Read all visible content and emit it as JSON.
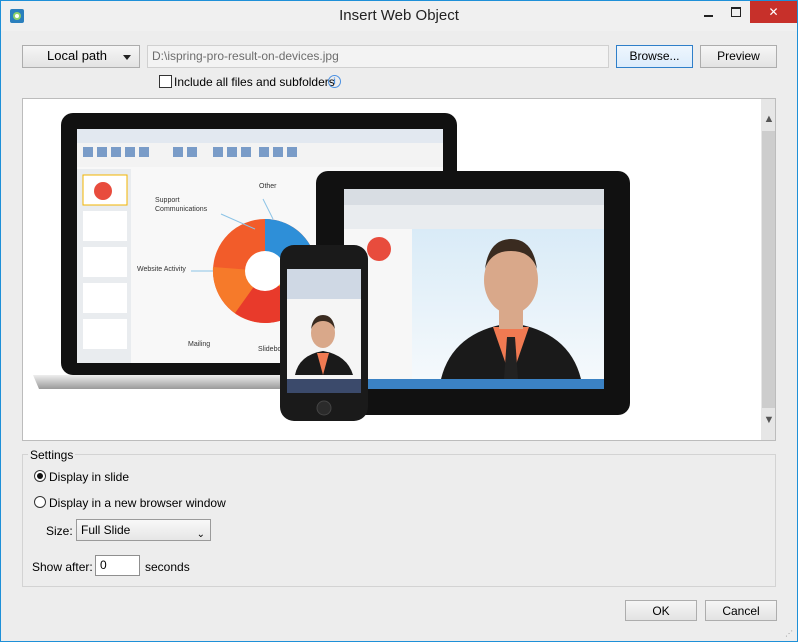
{
  "window": {
    "title": "Insert Web Object",
    "minimize_label": "",
    "maximize_label": "",
    "close_label": "✕"
  },
  "source": {
    "type_label": "Local path",
    "path_value": "D:\\ispring-pro-result-on-devices.jpg",
    "browse_label": "Browse...",
    "preview_label": "Preview",
    "include_label": "Include all files and subfolders",
    "include_checked": false
  },
  "preview_image": {
    "laptop_labels": {
      "support": "Support\nCommunications",
      "other": "Other",
      "website": "Website Activity",
      "mailing": "Mailing",
      "slideboo": "Slideboo"
    }
  },
  "settings": {
    "title": "Settings",
    "display_in_slide": "Display in slide",
    "display_in_browser": "Display in a new browser window",
    "size_label": "Size:",
    "size_value": "Full Slide",
    "show_after_label": "Show after:",
    "show_after_value": "0",
    "seconds_label": "seconds"
  },
  "buttons": {
    "ok": "OK",
    "cancel": "Cancel"
  },
  "colors": {
    "accent_border": "#1e90d8",
    "close_red": "#c7302a"
  }
}
